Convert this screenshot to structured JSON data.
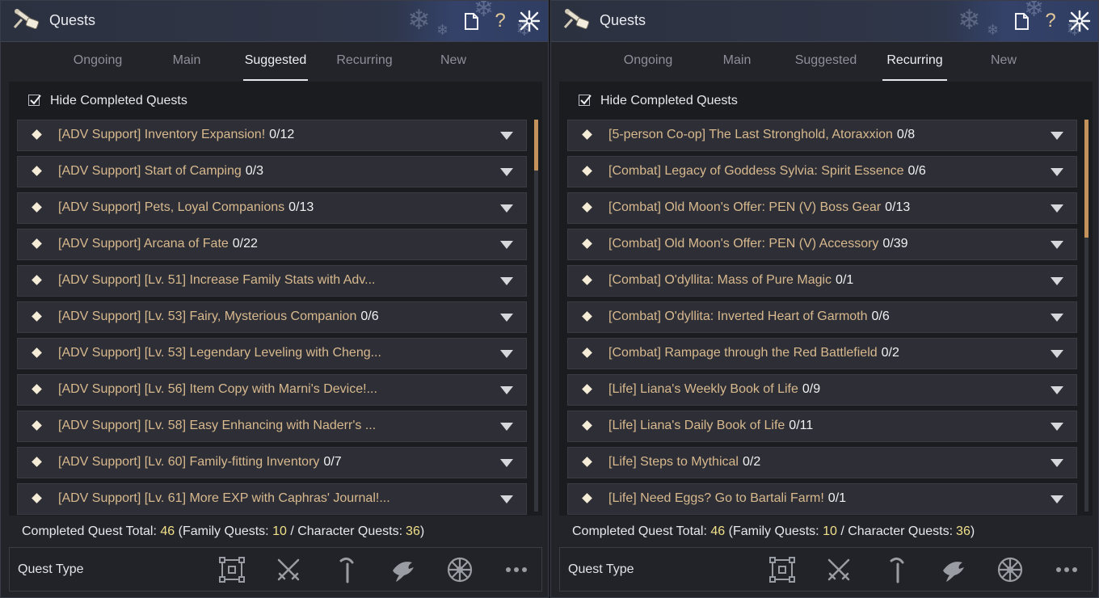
{
  "panels": [
    {
      "title": "Quests",
      "tabs": [
        "Ongoing",
        "Main",
        "Suggested",
        "Recurring",
        "New"
      ],
      "active_tab": "Suggested",
      "hide_completed_label": "Hide Completed Quests",
      "hide_completed_checked": true,
      "quests": [
        {
          "name": "[ADV Support] Inventory Expansion!",
          "count": "0/12"
        },
        {
          "name": "[ADV Support] Start of Camping",
          "count": "0/3"
        },
        {
          "name": "[ADV Support] Pets, Loyal Companions",
          "count": "0/13"
        },
        {
          "name": "[ADV Support] Arcana of Fate",
          "count": "0/22"
        },
        {
          "name": "[ADV Support] [Lv. 51] Increase Family Stats with Adv...",
          "count": ""
        },
        {
          "name": "[ADV Support] [Lv. 53] Fairy, Mysterious Companion",
          "count": "0/6"
        },
        {
          "name": "[ADV Support] [Lv. 53] Legendary Leveling with Cheng...",
          "count": ""
        },
        {
          "name": "[ADV Support] [Lv. 56] Item Copy with Marni's Device!...",
          "count": ""
        },
        {
          "name": "[ADV Support] [Lv. 58] Easy Enhancing with Naderr's ...",
          "count": ""
        },
        {
          "name": "[ADV Support] [Lv. 60] Family-fitting Inventory",
          "count": "0/7"
        },
        {
          "name": "[ADV Support] [Lv. 61] More EXP with Caphras' Journal!...",
          "count": ""
        }
      ],
      "scroll_position": 0.0,
      "scroll_visible_fraction": 0.13,
      "totals": {
        "label": "Completed Quest Total:",
        "total": "46",
        "family_label": "(Family Quests:",
        "family": "10",
        "char_label": "/ Character Quests:",
        "character": "36",
        "close_paren": ")"
      },
      "quest_type_label": "Quest Type"
    },
    {
      "title": "Quests",
      "tabs": [
        "Ongoing",
        "Main",
        "Suggested",
        "Recurring",
        "New"
      ],
      "active_tab": "Recurring",
      "hide_completed_label": "Hide Completed Quests",
      "hide_completed_checked": true,
      "quests": [
        {
          "name": "[5-person Co-op] The Last Stronghold, Atoraxxion",
          "count": "0/8"
        },
        {
          "name": "[Combat] Legacy of Goddess Sylvia: Spirit Essence",
          "count": "0/6"
        },
        {
          "name": "[Combat] Old Moon's Offer: PEN (V) Boss Gear",
          "count": "0/13"
        },
        {
          "name": "[Combat] Old Moon's Offer: PEN (V) Accessory",
          "count": "0/39"
        },
        {
          "name": "[Combat] O'dyllita: Mass of Pure Magic",
          "count": "0/1"
        },
        {
          "name": "[Combat] O'dyllita: Inverted Heart of Garmoth",
          "count": "0/6"
        },
        {
          "name": "[Combat] Rampage through the Red Battlefield",
          "count": "0/2"
        },
        {
          "name": "[Life] Liana's Weekly Book of Life",
          "count": "0/9"
        },
        {
          "name": "[Life] Liana's Daily Book of Life",
          "count": "0/11"
        },
        {
          "name": "[Life] Steps to Mythical",
          "count": "0/2"
        },
        {
          "name": "[Life] Need Eggs? Go to Bartali Farm!",
          "count": "0/1"
        }
      ],
      "scroll_position": 0.0,
      "scroll_visible_fraction": 0.3,
      "totals": {
        "label": "Completed Quest Total:",
        "total": "46",
        "family_label": "(Family Quests:",
        "family": "10",
        "char_label": "/ Character Quests:",
        "character": "36",
        "close_paren": ")"
      },
      "quest_type_label": "Quest Type"
    }
  ],
  "quest_type_icons": [
    "all-types-icon",
    "combat-icon",
    "life-gathering-icon",
    "fishing-icon",
    "trade-wheel-icon",
    "more-icon"
  ],
  "colors": {
    "quest_name": "#d8b98e",
    "quest_count": "#f1f1f3",
    "totals_number": "#f0e08a",
    "scroll_thumb": "#c4935c",
    "icon_gray": "#9a9ca3"
  }
}
